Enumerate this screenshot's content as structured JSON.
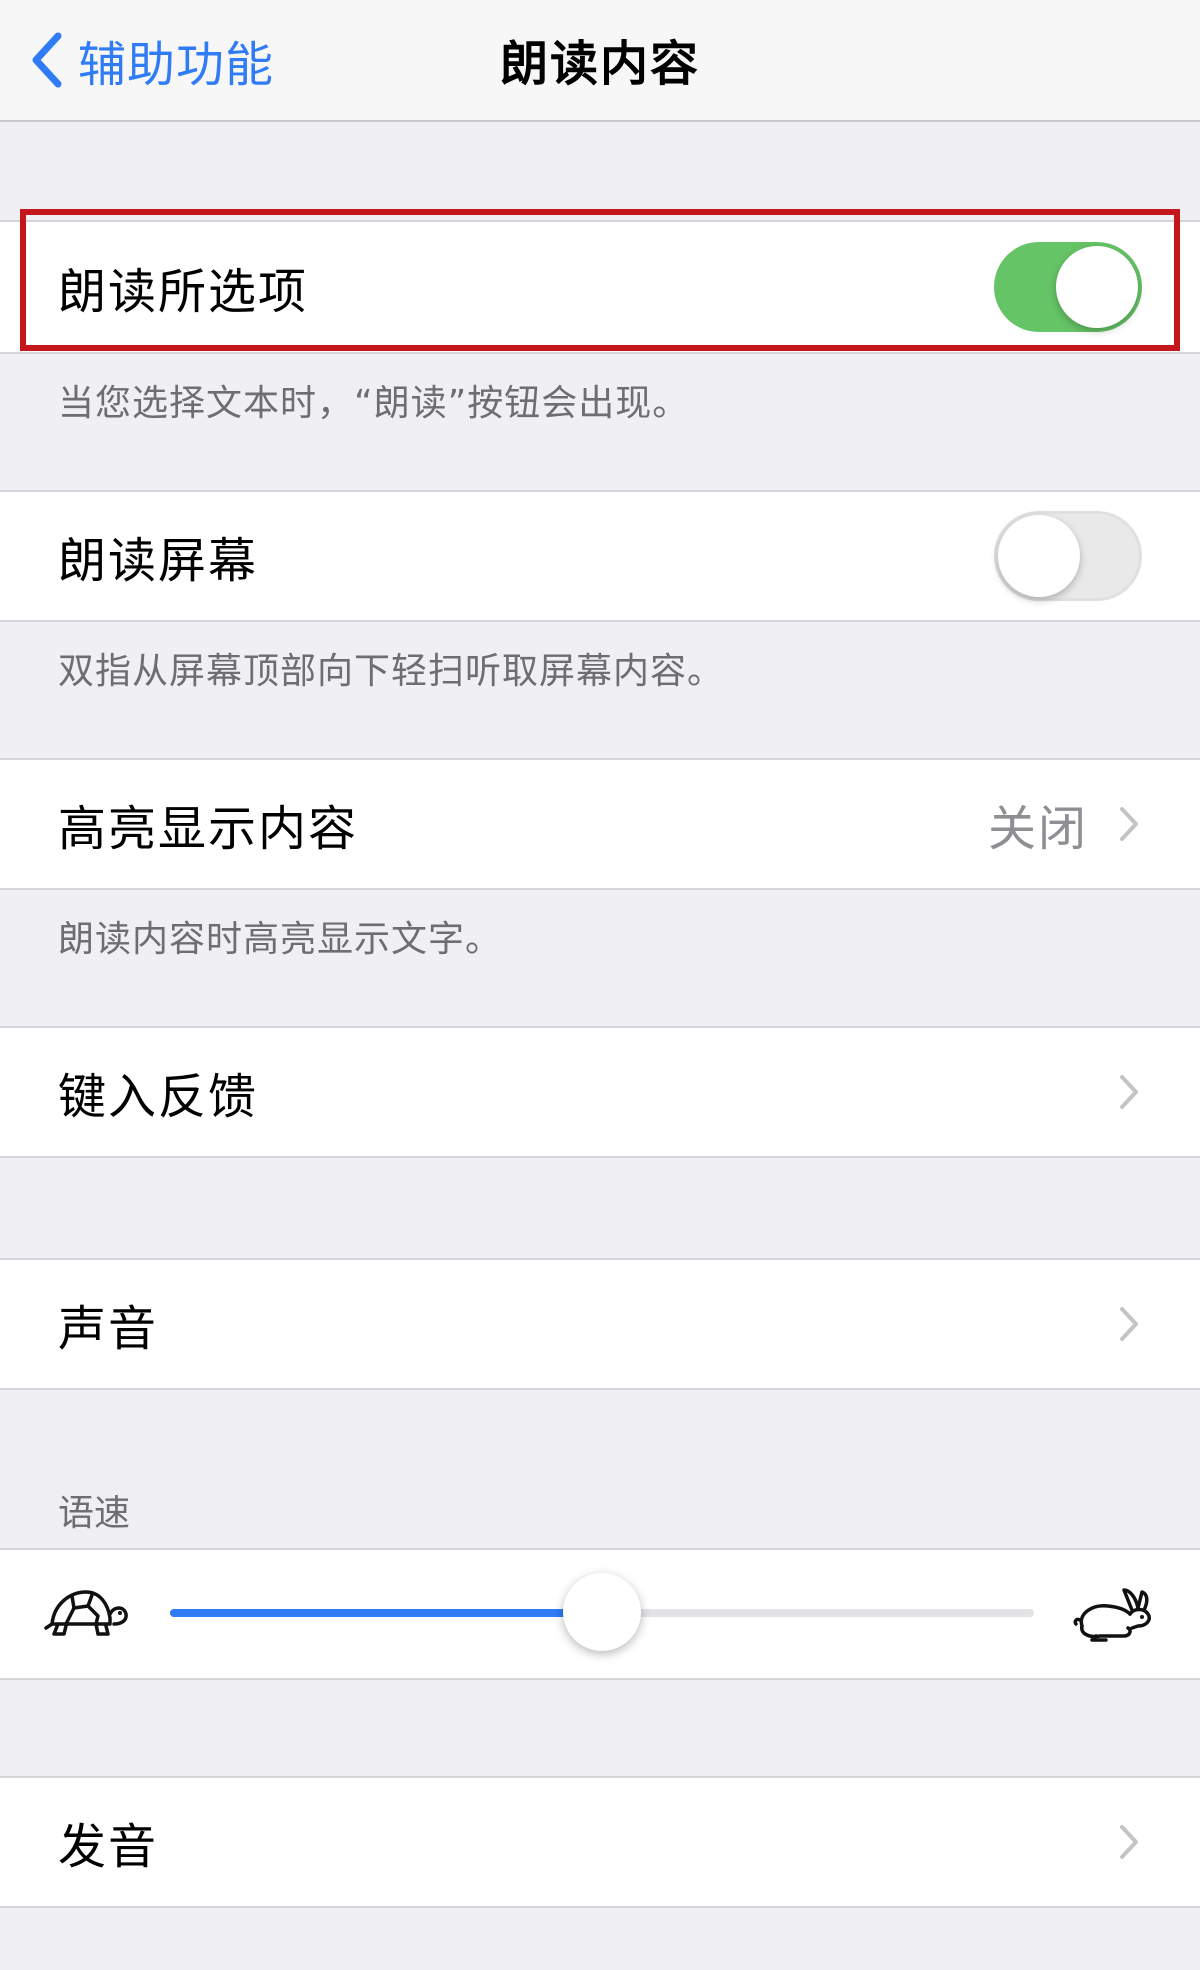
{
  "nav": {
    "back_label": "辅助功能",
    "title": "朗读内容"
  },
  "rows": {
    "speak_selection": {
      "label": "朗读所选项",
      "toggle_on": true
    },
    "speak_selection_footer": "当您选择文本时，“朗读”按钮会出现。",
    "speak_screen": {
      "label": "朗读屏幕",
      "toggle_on": false
    },
    "speak_screen_footer": "双指从屏幕顶部向下轻扫听取屏幕内容。",
    "highlight_content": {
      "label": "高亮显示内容",
      "value": "关闭"
    },
    "highlight_content_footer": "朗读内容时高亮显示文字。",
    "typing_feedback": {
      "label": "键入反馈"
    },
    "voices": {
      "label": "声音"
    },
    "speaking_rate_header": "语速",
    "pronunciations": {
      "label": "发音"
    }
  },
  "speaking_rate": {
    "value": 0.5,
    "min_icon": "turtle-icon",
    "max_icon": "rabbit-icon"
  },
  "colors": {
    "accent": "#2f7cf6",
    "switch_on": "#65c466",
    "highlight_box": "#c5161d",
    "background": "#efeff4"
  }
}
